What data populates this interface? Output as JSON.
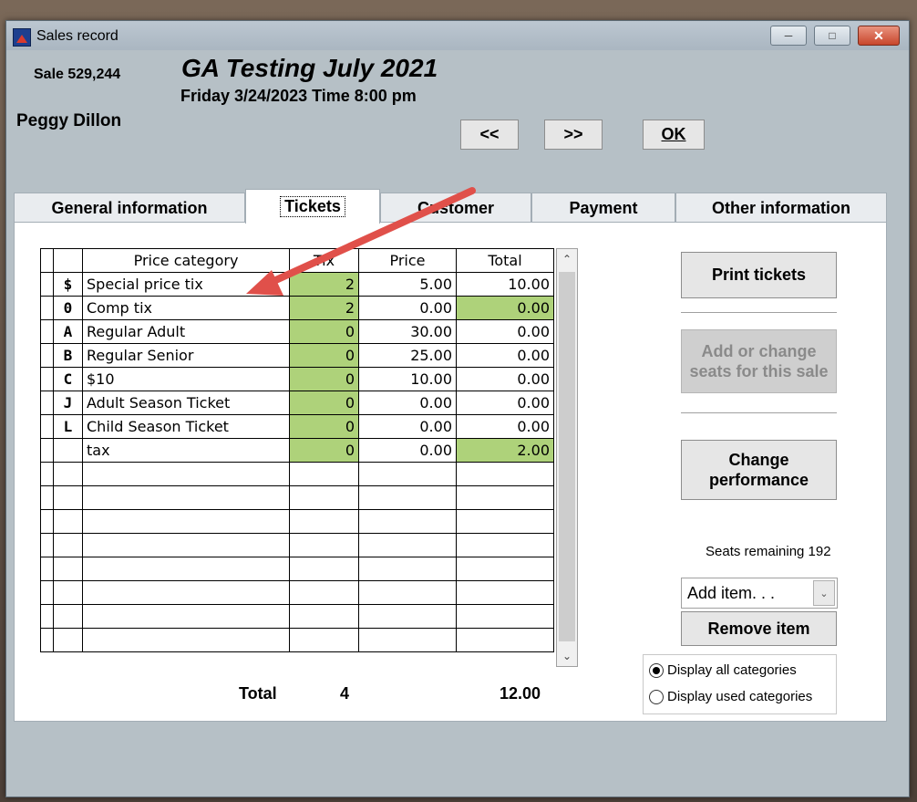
{
  "window": {
    "title": "Sales record"
  },
  "header": {
    "sale_number": "Sale 529,244",
    "event_title": "GA Testing July 2021",
    "event_date": "Friday 3/24/2023  Time 8:00 pm",
    "customer_name": "Peggy Dillon",
    "prev_label": "<<",
    "next_label": ">>",
    "ok_label": "OK"
  },
  "tabs": [
    {
      "label": "General information"
    },
    {
      "label": "Tickets",
      "active": true
    },
    {
      "label": "Customer"
    },
    {
      "label": "Payment"
    },
    {
      "label": "Other information"
    }
  ],
  "grid": {
    "headers": {
      "category": "Price category",
      "tix": "Tix",
      "price": "Price",
      "total": "Total"
    },
    "rows": [
      {
        "code": "$",
        "name": "Special price tix",
        "tix": "2",
        "price": "5.00",
        "total": "10.00",
        "tix_green": true,
        "total_green": false
      },
      {
        "code": "0",
        "name": "Comp tix",
        "tix": "2",
        "price": "0.00",
        "total": "0.00",
        "tix_green": true,
        "total_green": true
      },
      {
        "code": "A",
        "name": "Regular Adult",
        "tix": "0",
        "price": "30.00",
        "total": "0.00",
        "tix_green": true,
        "total_green": false
      },
      {
        "code": "B",
        "name": "Regular Senior",
        "tix": "0",
        "price": "25.00",
        "total": "0.00",
        "tix_green": true,
        "total_green": false
      },
      {
        "code": "C",
        "name": "$10",
        "tix": "0",
        "price": "10.00",
        "total": "0.00",
        "tix_green": true,
        "total_green": false
      },
      {
        "code": "J",
        "name": "Adult Season Ticket",
        "tix": "0",
        "price": "0.00",
        "total": "0.00",
        "tix_green": true,
        "total_green": false
      },
      {
        "code": "L",
        "name": "Child Season Ticket",
        "tix": "0",
        "price": "0.00",
        "total": "0.00",
        "tix_green": true,
        "total_green": false
      },
      {
        "code": "",
        "name": "tax",
        "tix": "0",
        "price": "0.00",
        "total": "2.00",
        "tix_green": true,
        "total_green": true
      },
      {
        "code": "",
        "name": "",
        "tix": "",
        "price": "",
        "total": ""
      },
      {
        "code": "",
        "name": "",
        "tix": "",
        "price": "",
        "total": ""
      },
      {
        "code": "",
        "name": "",
        "tix": "",
        "price": "",
        "total": ""
      },
      {
        "code": "",
        "name": "",
        "tix": "",
        "price": "",
        "total": ""
      },
      {
        "code": "",
        "name": "",
        "tix": "",
        "price": "",
        "total": ""
      },
      {
        "code": "",
        "name": "",
        "tix": "",
        "price": "",
        "total": ""
      },
      {
        "code": "",
        "name": "",
        "tix": "",
        "price": "",
        "total": ""
      },
      {
        "code": "",
        "name": "",
        "tix": "",
        "price": "",
        "total": ""
      }
    ]
  },
  "totals": {
    "label": "Total",
    "tix": "4",
    "amount": "12.00"
  },
  "actions": {
    "print_tickets": "Print tickets",
    "add_change_seats": "Add or change seats for this sale",
    "change_performance": "Change performance",
    "seats_remaining": "Seats remaining 192",
    "add_item_value": "Add item. . .",
    "remove_item": "Remove item"
  },
  "display_options": {
    "all": "Display all categories",
    "used": "Display used categories",
    "selected": "all"
  },
  "colors": {
    "highlight_green": "#aed27a",
    "annotation_arrow": "#e0504a"
  }
}
